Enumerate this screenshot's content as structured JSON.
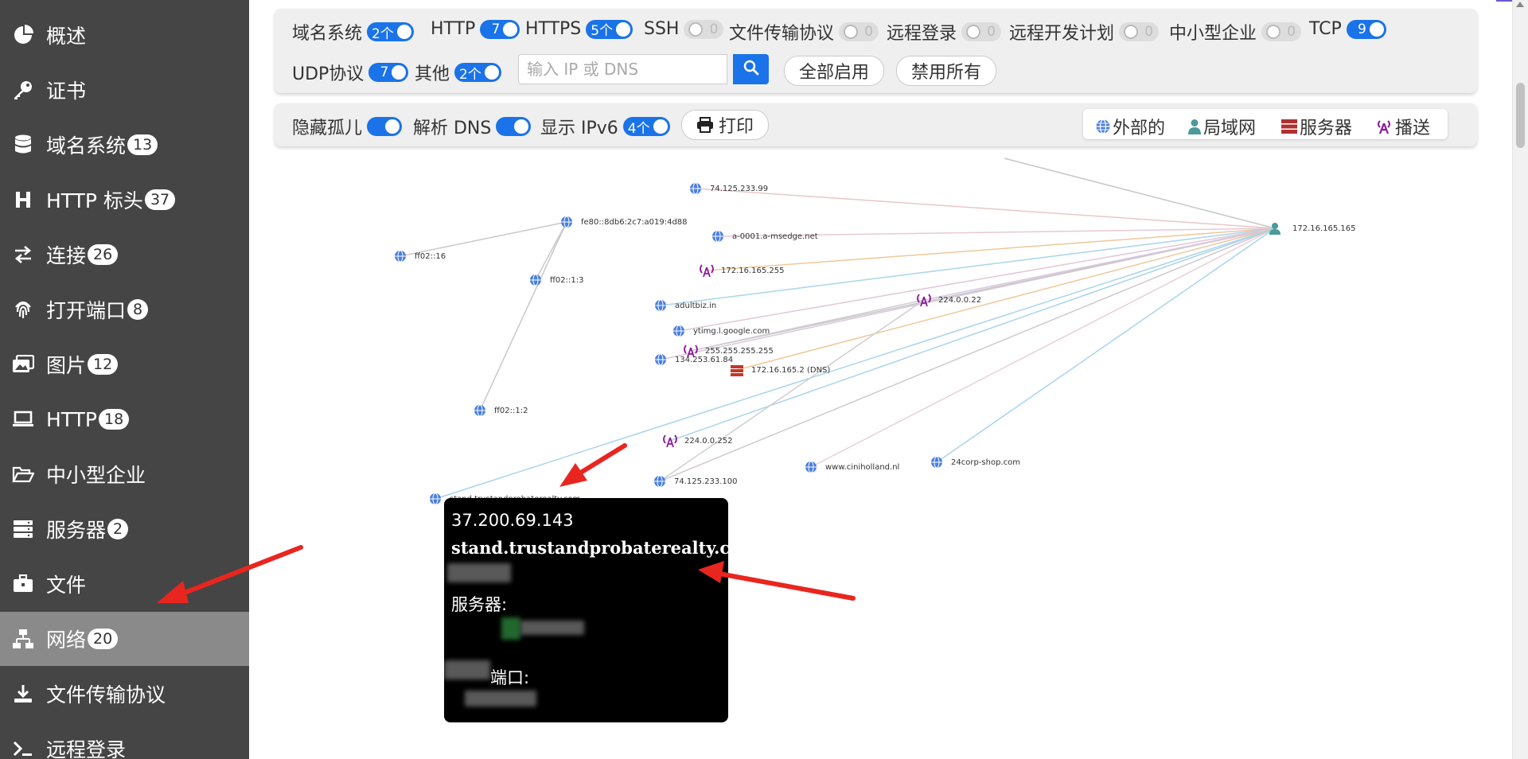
{
  "sidebar": {
    "items": [
      {
        "label": "概述",
        "icon": "pie-chart-icon",
        "badge": ""
      },
      {
        "label": "证书",
        "icon": "key-icon",
        "badge": ""
      },
      {
        "label": "域名系统",
        "icon": "database-icon",
        "badge": "13"
      },
      {
        "label": "HTTP 标头",
        "icon": "header-icon",
        "badge": "37"
      },
      {
        "label": "连接",
        "icon": "exchange-icon",
        "badge": "26"
      },
      {
        "label": "打开端口",
        "icon": "fingerprint-icon",
        "badge": "8"
      },
      {
        "label": "图片",
        "icon": "images-icon",
        "badge": "12"
      },
      {
        "label": "HTTP",
        "icon": "laptop-icon",
        "badge": "18"
      },
      {
        "label": "中小型企业",
        "icon": "folder-open-icon",
        "badge": ""
      },
      {
        "label": "服务器",
        "icon": "server-icon",
        "badge": "2"
      },
      {
        "label": "文件",
        "icon": "briefcase-icon",
        "badge": ""
      },
      {
        "label": "网络",
        "icon": "network-icon",
        "badge": "20",
        "active": true
      },
      {
        "label": "文件传输协议",
        "icon": "download-icon",
        "badge": ""
      },
      {
        "label": "远程登录",
        "icon": "terminal-icon",
        "badge": ""
      }
    ]
  },
  "filters": {
    "dns": {
      "label": "域名系统",
      "value": "2个",
      "on": true
    },
    "http": {
      "label": "HTTP",
      "value": "7",
      "on": true
    },
    "https": {
      "label": "HTTPS",
      "value": "5个",
      "on": true
    },
    "ssh": {
      "label": "SSH",
      "value": "0",
      "on": false
    },
    "ftp": {
      "label": "文件传输协议",
      "value": "0",
      "on": false
    },
    "telnet": {
      "label": "远程登录",
      "value": "0",
      "on": false
    },
    "rdp": {
      "label": "远程开发计划",
      "value": "0",
      "on": false
    },
    "smb": {
      "label": "中小型企业",
      "value": "0",
      "on": false
    },
    "tcp": {
      "label": "TCP",
      "value": "9",
      "on": true
    },
    "udp": {
      "label": "UDP协议",
      "value": "7",
      "on": true
    },
    "other": {
      "label": "其他",
      "value": "2个",
      "on": true
    }
  },
  "search": {
    "placeholder": "输入 IP 或 DNS",
    "value": ""
  },
  "buttons": {
    "enable_all": "全部启用",
    "disable_all": "禁用所有",
    "print": "打印"
  },
  "options": {
    "hide_orphans": {
      "label": "隐藏孤儿",
      "value": "",
      "on": true
    },
    "resolve_dns": {
      "label": "解析 DNS",
      "value": "",
      "on": true
    },
    "show_ipv6": {
      "label": "显示 IPv6",
      "value": "4个",
      "on": true
    }
  },
  "legend": {
    "external": "外部的",
    "lan": "局域网",
    "server": "服务器",
    "broadcast": "播送"
  },
  "colors": {
    "accent": "#1a73e8",
    "sidebar_bg": "#454545",
    "sidebar_active": "#8a8a8a",
    "globe": "#4a7fe0",
    "lan": "#4a9a9a",
    "server": "#c0392b",
    "broadcast": "#8b1a9b"
  },
  "graph": {
    "nodes": [
      {
        "id": "172.16.165.165",
        "label": "172.16.165.165",
        "type": "lan"
      },
      {
        "id": "74.125.233.99",
        "label": "74.125.233.99",
        "type": "external"
      },
      {
        "id": "fe80",
        "label": "fe80::8db6:2c7:a019:4d88",
        "type": "external"
      },
      {
        "id": "a-0001",
        "label": "a-0001.a-msedge.net",
        "type": "external"
      },
      {
        "id": "ff02::16",
        "label": "ff02::16",
        "type": "external"
      },
      {
        "id": "bcast255",
        "label": "172.16.165.255",
        "type": "broadcast"
      },
      {
        "id": "ff02::1:3",
        "label": "ff02::1:3",
        "type": "external"
      },
      {
        "id": "224.0.0.22",
        "label": "224.0.0.22",
        "type": "broadcast"
      },
      {
        "id": "adultbiz",
        "label": "adultbiz.in",
        "type": "external"
      },
      {
        "id": "ytimg",
        "label": "ytimg.l.google.com",
        "type": "external"
      },
      {
        "id": "255",
        "label": "255.255.255.255",
        "type": "broadcast"
      },
      {
        "id": "134",
        "label": "134.253.61.84",
        "type": "external"
      },
      {
        "id": "dns",
        "label": "172.16.165.2 (DNS)",
        "type": "server"
      },
      {
        "id": "ff02::1:2",
        "label": "ff02::1:2",
        "type": "external"
      },
      {
        "id": "224.0.0.252",
        "label": "224.0.0.252",
        "type": "broadcast"
      },
      {
        "id": "cinih",
        "label": "www.ciniholland.nl",
        "type": "external"
      },
      {
        "id": "24corp",
        "label": "24corp-shop.com",
        "type": "external"
      },
      {
        "id": "74.100",
        "label": "74.125.233.100",
        "type": "external"
      },
      {
        "id": "stand",
        "label": "stand.trustandprobaterealty.com",
        "type": "external"
      }
    ]
  },
  "tooltip": {
    "ip": "37.200.69.143",
    "host": "stand.trustandprobaterealty.com",
    "server_label": "服务器:",
    "port_label": "端口:"
  }
}
